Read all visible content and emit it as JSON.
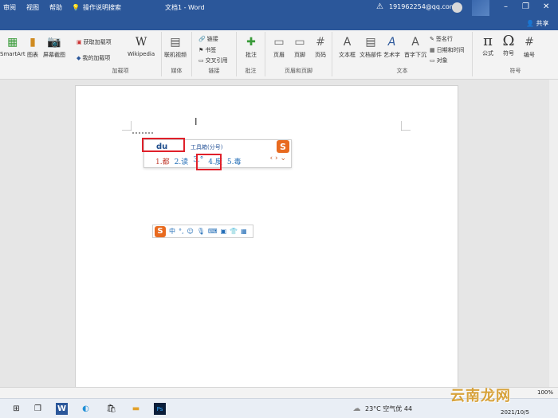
{
  "titlebar": {
    "tabs": [
      "审阅",
      "视图",
      "帮助"
    ],
    "tell_me": "操作说明搜索",
    "doc_title": "文档1 - Word",
    "email": "191962254@qq.com",
    "share": "共享"
  },
  "ribbon": {
    "groups": [
      {
        "name": "加载项",
        "items": [
          "SmartArt",
          "图表",
          "屏幕截图",
          "获取加载项",
          "我的加载项",
          "Wikipedia"
        ]
      },
      {
        "name": "媒体",
        "items": [
          "联机视频"
        ]
      },
      {
        "name": "链接",
        "items": [
          "链接",
          "书签",
          "交叉引用"
        ]
      },
      {
        "name": "批注",
        "items": [
          "批注"
        ]
      },
      {
        "name": "页眉和页脚",
        "items": [
          "页眉",
          "页脚",
          "页码"
        ]
      },
      {
        "name": "文本",
        "items": [
          "文本框",
          "文档部件",
          "艺术字",
          "首字下沉",
          "签名行",
          "日期和时间",
          "对象"
        ]
      },
      {
        "name": "符号",
        "items": [
          "公式",
          "符号",
          "编号"
        ]
      }
    ]
  },
  "ime": {
    "composition": "du",
    "hint": "工具箱(分号)",
    "candidates": [
      "1.都",
      "2.读",
      "3.°",
      "4.度",
      "5.毒"
    ]
  },
  "statusbar": {
    "zoom": "100%"
  },
  "taskbar": {
    "weather": "23°C  空气优 44",
    "date": "2021/10/5",
    "watermark": "云南龙网"
  }
}
